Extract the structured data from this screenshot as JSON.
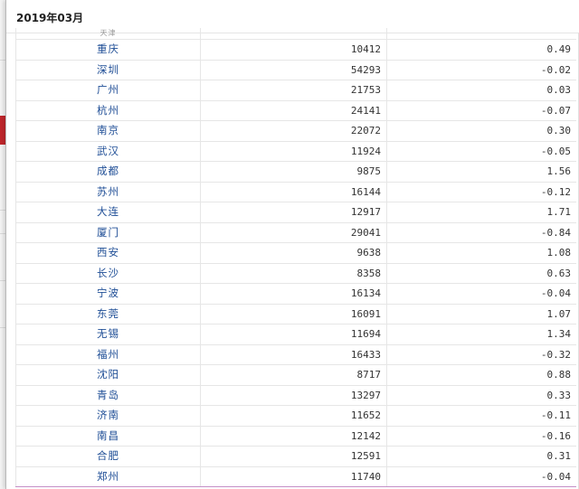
{
  "header": {
    "title": "2019年03月"
  },
  "table": {
    "partial_row": {
      "city": "天津"
    },
    "rows": [
      {
        "city": "重庆",
        "value": "10412",
        "change": "0.49"
      },
      {
        "city": "深圳",
        "value": "54293",
        "change": "-0.02"
      },
      {
        "city": "广州",
        "value": "21753",
        "change": "0.03"
      },
      {
        "city": "杭州",
        "value": "24141",
        "change": "-0.07"
      },
      {
        "city": "南京",
        "value": "22072",
        "change": "0.30"
      },
      {
        "city": "武汉",
        "value": "11924",
        "change": "-0.05"
      },
      {
        "city": "成都",
        "value": "9875",
        "change": "1.56"
      },
      {
        "city": "苏州",
        "value": "16144",
        "change": "-0.12"
      },
      {
        "city": "大连",
        "value": "12917",
        "change": "1.71"
      },
      {
        "city": "厦门",
        "value": "29041",
        "change": "-0.84"
      },
      {
        "city": "西安",
        "value": "9638",
        "change": "1.08"
      },
      {
        "city": "长沙",
        "value": "8358",
        "change": "0.63"
      },
      {
        "city": "宁波",
        "value": "16134",
        "change": "-0.04"
      },
      {
        "city": "东莞",
        "value": "16091",
        "change": "1.07"
      },
      {
        "city": "无锡",
        "value": "11694",
        "change": "1.34"
      },
      {
        "city": "福州",
        "value": "16433",
        "change": "-0.32"
      },
      {
        "city": "沈阳",
        "value": "8717",
        "change": "0.88"
      },
      {
        "city": "青岛",
        "value": "13297",
        "change": "0.33"
      },
      {
        "city": "济南",
        "value": "11652",
        "change": "-0.11"
      },
      {
        "city": "南昌",
        "value": "12142",
        "change": "-0.16"
      },
      {
        "city": "合肥",
        "value": "12591",
        "change": "0.31"
      },
      {
        "city": "郑州",
        "value": "11740",
        "change": "-0.04"
      }
    ]
  },
  "colors": {
    "city_link": "#1f4e96",
    "highlight_border": "#c48ec7",
    "grid": "#e6e6e6"
  }
}
